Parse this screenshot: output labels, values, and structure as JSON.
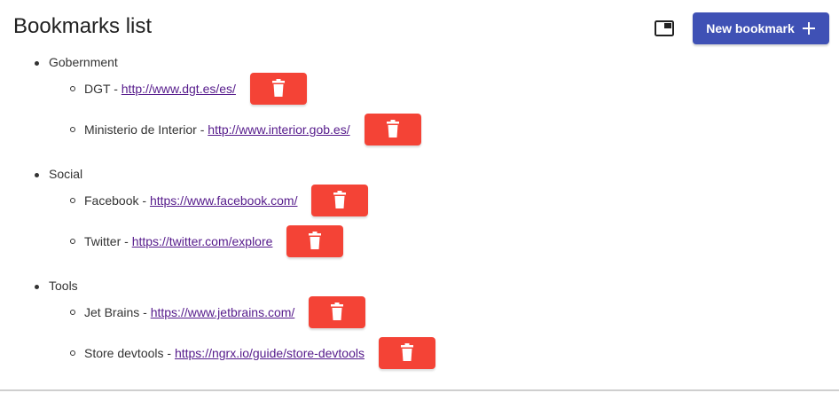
{
  "header": {
    "title": "Bookmarks list",
    "new_button_label": "New bookmark"
  },
  "groups": [
    {
      "name": "Gobernment",
      "bookmarks": [
        {
          "name": "DGT",
          "url": "http://www.dgt.es/es/"
        },
        {
          "name": "Ministerio de Interior",
          "url": "http://www.interior.gob.es/"
        }
      ]
    },
    {
      "name": "Social",
      "bookmarks": [
        {
          "name": "Facebook",
          "url": "https://www.facebook.com/"
        },
        {
          "name": "Twitter",
          "url": "https://twitter.com/explore"
        }
      ]
    },
    {
      "name": "Tools",
      "bookmarks": [
        {
          "name": "Jet Brains",
          "url": "https://www.jetbrains.com/"
        },
        {
          "name": "Store devtools",
          "url": "https://ngrx.io/guide/store-devtools"
        }
      ]
    }
  ],
  "colors": {
    "primary": "#3f51b5",
    "delete": "#f44336",
    "link": "#551a8b"
  },
  "icons": {
    "window": "window-icon",
    "add": "plus-icon",
    "delete": "trash-icon"
  }
}
